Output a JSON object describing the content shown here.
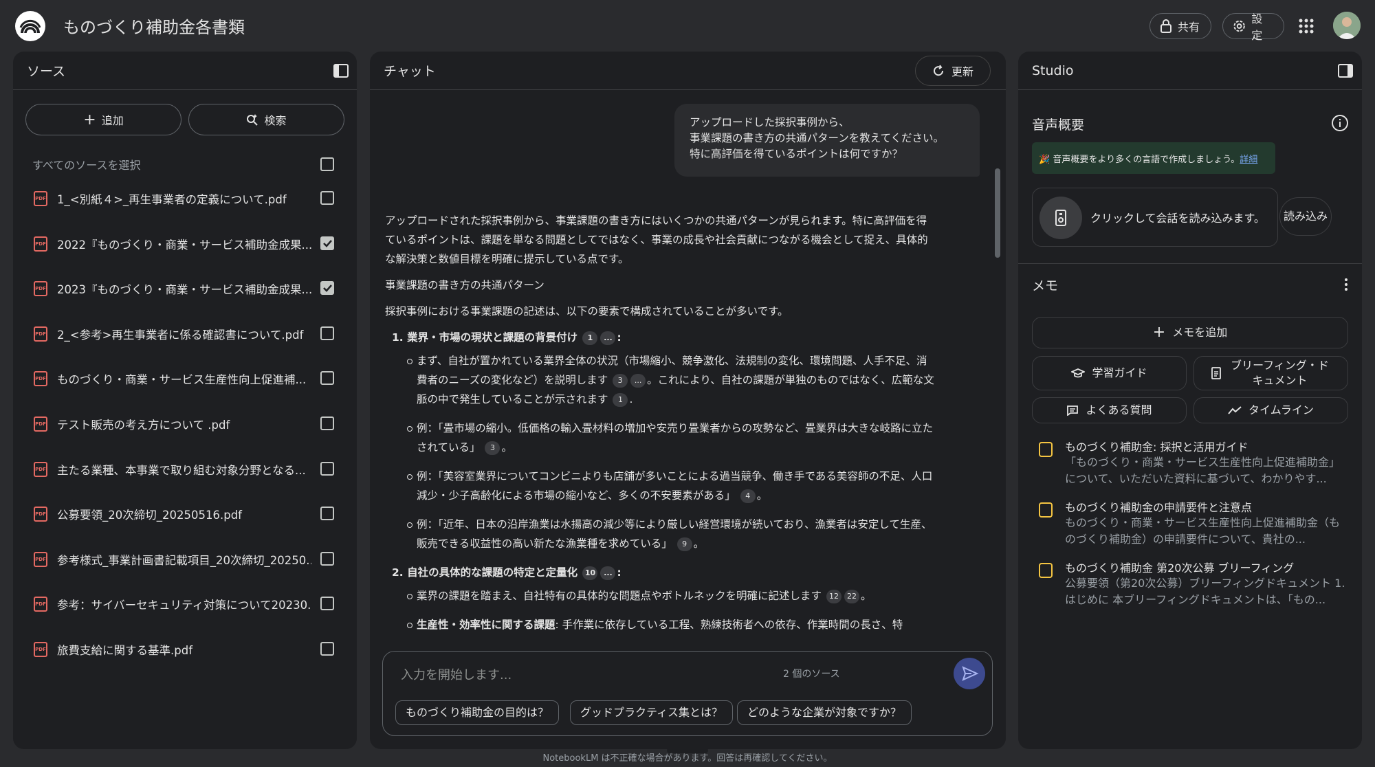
{
  "app": {
    "title": "ものづくり補助金各書類",
    "share_label": "共有",
    "settings_label": "設定"
  },
  "sources": {
    "title": "ソース",
    "add_label": "追加",
    "search_label": "検索",
    "select_all_label": "すべてのソースを選択",
    "items": [
      {
        "name": "1_<別紙４>_再生事業者の定義について.pdf",
        "checked": false
      },
      {
        "name": "2022『ものづくり・商業・サービス補助金成果...",
        "checked": true
      },
      {
        "name": "2023『ものづくり・商業・サービス補助金成果...",
        "checked": true
      },
      {
        "name": "2_<参考>再生事業者に係る確認書について.pdf",
        "checked": false
      },
      {
        "name": "ものづくり・商業・サービス生産性向上促進補...",
        "checked": false
      },
      {
        "name": "テスト販売の考え方について .pdf",
        "checked": false
      },
      {
        "name": "主たる業種、本事業で取り組む対象分野となる...",
        "checked": false
      },
      {
        "name": "公募要領_20次締切_20250516.pdf",
        "checked": false
      },
      {
        "name": "参考様式_事業計画書記載項目_20次締切_20250...",
        "checked": false
      },
      {
        "name": "参考：サイバーセキュリティ対策について20230...",
        "checked": false
      },
      {
        "name": "旅費支給に関する基準.pdf",
        "checked": false
      }
    ]
  },
  "chat": {
    "title": "チャット",
    "refresh_label": "更新",
    "user_message": [
      "アップロードした採択事例から、",
      "事業課題の書き方の共通パターンを教えてください。",
      "特に高評価を得ているポイントは何ですか？"
    ],
    "intro": "アップロードされた採択事例から、事業課題の書き方にはいくつかの共通パターンが見られます。特に高評価を得ているポイントは、課題を単なる問題としてではなく、事業の成長や社会貢献につながる機会として捉え、具体的な解決策と数値目標を明確に提示している点です。",
    "section_title": "事業課題の書き方の共通パターン",
    "section_lead": "採択事例における事業課題の記述は、以下の要素で構成されていることが多いです。",
    "item1_title": "1. 業界・市場の現状と課題の背景付け",
    "item1_b1": "まず、自社が置かれている業界全体の状況（市場縮小、競争激化、法規制の変化、環境問題、人手不足、消費者のニーズの変化など）を説明します",
    "item1_b1_mid": "。これにより、自社の課題が単独のものではなく、広範な文脈の中で発生していることが示されます",
    "item1_b2": "例：「畳市場の縮小。低価格の輸入畳材料の増加や安売り畳業者からの攻勢など、畳業界は大きな岐路に立たされている」",
    "item1_b3": "例：「美容室業界についてコンビニよりも店舗が多いことによる過当競争、働き手である美容師の不足、人口減少・少子高齢化による市場の縮小など、多くの不安要素がある」",
    "item1_b4": "例：「近年、日本の沿岸漁業は水揚高の減少等により厳しい経営環境が続いており、漁業者は安定して生産、販売できる収益性の高い新たな漁業種を求めている」",
    "item2_title": "2. 自社の具体的な課題の特定と定量化",
    "item2_b1": "業界の課題を踏まえ、自社特有の具体的な問題点やボトルネックを明確に記述します",
    "item2_b2_bold": "生産性・効率性に関する課題",
    "item2_b2": ": 手作業に依存している工程、熟練技術者への依存、作業時間の長さ、特",
    "cite": {
      "c1": "1",
      "c3": "3",
      "c4": "4",
      "c9": "9",
      "c10": "10",
      "c12": "12",
      "c22": "22",
      "more": "..."
    },
    "input_placeholder": "入力を開始します...",
    "source_count": "2 個のソース",
    "suggestions": [
      "ものづくり補助金の目的は？",
      "グッドプラクティス集とは？",
      "どのような企業が対象ですか？"
    ]
  },
  "studio": {
    "title": "Studio",
    "audio_title": "音声概要",
    "banner_text": "音声概要をより多くの言語で作成しましょう。",
    "banner_link": "詳細",
    "load_text": "クリックして会話を読み込みます。",
    "load_button": "読み込み",
    "memo_title": "メモ",
    "add_memo": "メモを追加",
    "study_guide": "学習ガイド",
    "briefing_doc": "ブリーフィング・ドキュメント",
    "faq": "よくある質問",
    "timeline": "タイムライン",
    "notes": [
      {
        "title": "ものづくり補助金: 採択と活用ガイド",
        "body": "「ものづくり・商業・サービス生産性向上促進補助金」について、いただいた資料に基づいて、わかりやす..."
      },
      {
        "title": "ものづくり補助金の申請要件と注意点",
        "body": "ものづくり・商業・サービス生産性向上促進補助金（ものづくり補助金）の申請要件について、貴社の..."
      },
      {
        "title": "ものづくり補助金 第20次公募 ブリーフィング",
        "body": "公募要領（第20次公募）ブリーフィングドキュメント 1. はじめに 本ブリーフィングドキュメントは、「もの..."
      }
    ]
  },
  "footer": "NotebookLM は不正確な場合があります。回答は再確認してください。"
}
